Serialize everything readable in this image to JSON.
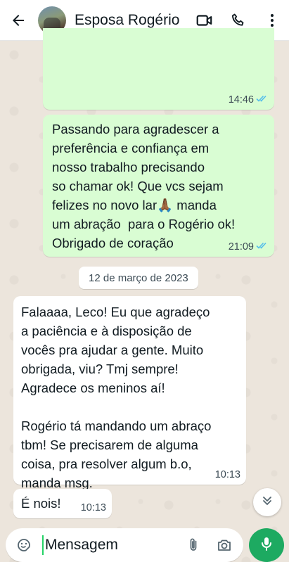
{
  "header": {
    "contact_name": "Esposa Rogério"
  },
  "messages": [
    {
      "direction": "out",
      "text": "",
      "time": "14:46",
      "status": "read"
    },
    {
      "direction": "out",
      "text": "Passando para agradescer a\npreferência e confiança em\nnosso trabalho precisando\nso chamar ok! Que vcs sejam\nfelizes no novo lar🙏🏾 manda\num abração  para o Rogério ok!\nObrigado de coração",
      "time": "21:09",
      "status": "read"
    },
    {
      "direction": "in",
      "text": "Falaaaa, Leco! Eu que agradeço\na paciência e à disposição de\nvocês pra ajudar a gente. Muito\nobrigada, viu? Tmj sempre!\nAgradece os meninos aí!\n\nRogério tá mandando um abraço\ntbm! Se precisarem de alguma\ncoisa, pra resolver algum b.o,\nmanda msg.",
      "time": "10:13"
    },
    {
      "direction": "in",
      "text": "É nois!",
      "time": "10:13"
    }
  ],
  "date_separator": "12 de março de 2023",
  "composer": {
    "placeholder": "Mensagem"
  },
  "colors": {
    "outgoing_bubble": "#d9fdd3",
    "incoming_bubble": "#ffffff",
    "read_ticks": "#53bdeb",
    "mic_button": "#1daa61"
  },
  "icons": [
    "back-arrow-icon",
    "video-call-icon",
    "phone-icon",
    "more-options-icon",
    "double-check-icon",
    "scroll-down-icon",
    "sticker-icon",
    "attach-icon",
    "camera-icon",
    "mic-icon"
  ]
}
